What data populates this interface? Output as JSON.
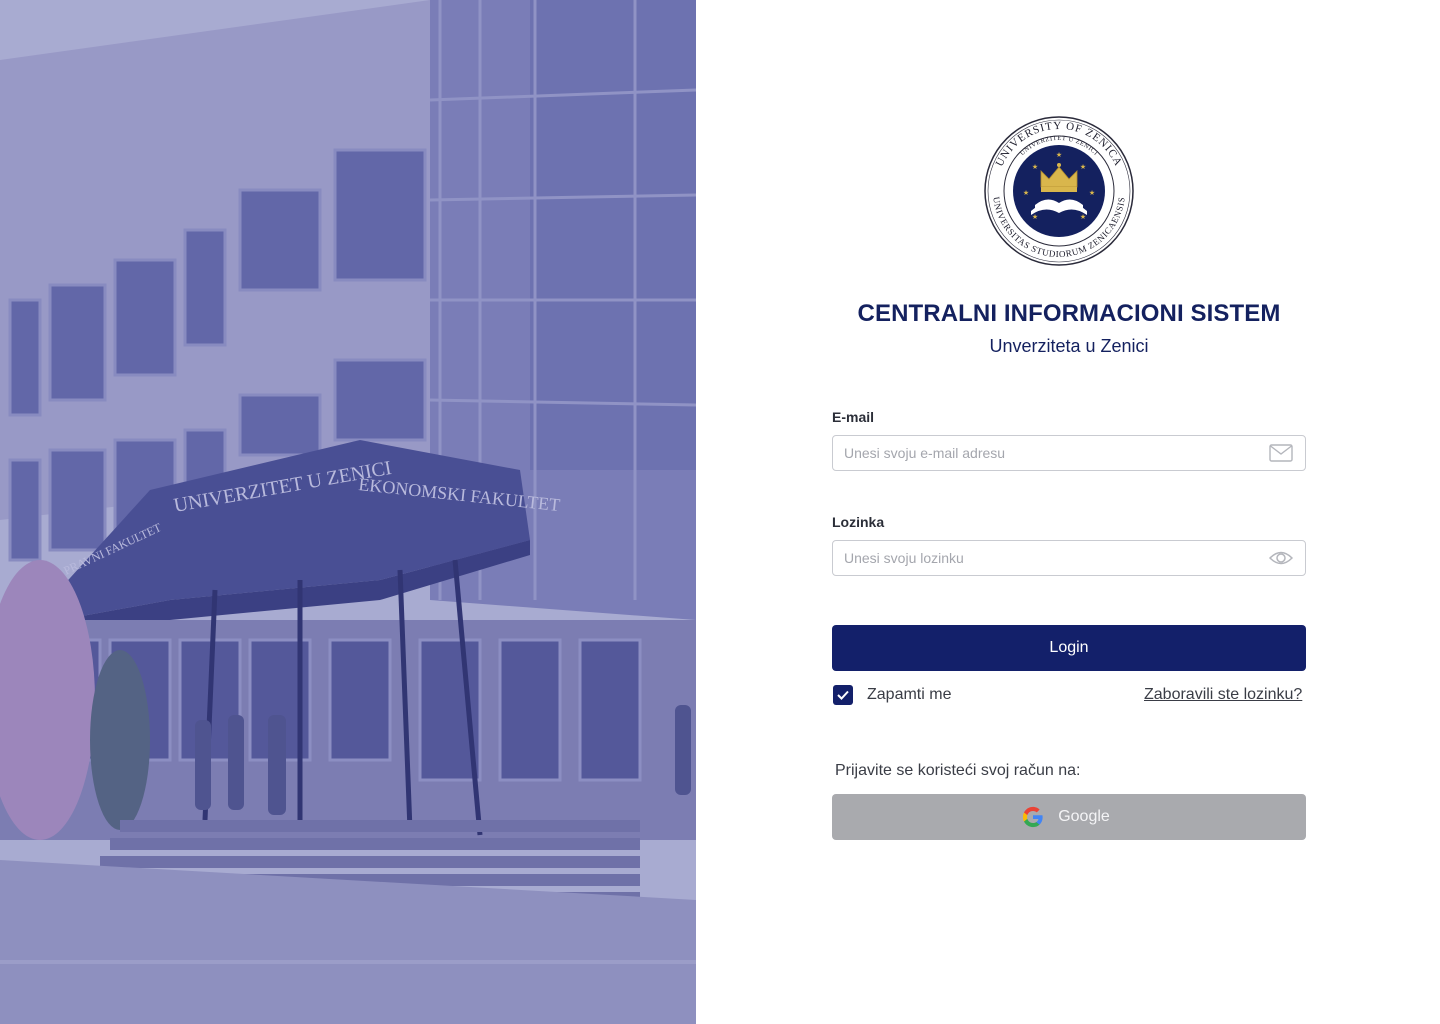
{
  "hero": {
    "image_description_hidden": "",
    "building_sign_left": "UNIVERZITET U ZENICI",
    "building_sign_right": "EKONOMSKI FAKULTET",
    "building_sign_side": "PRAVNI FAKULTET"
  },
  "brand": {
    "seal_text_outer": "UNIVERSITY OF ZENICA",
    "seal_text_inner": "UNIVERZITET U ZENICI",
    "seal_text_bottom": "UNIVERSITAS STUDIORUM ZENICAENSIS",
    "title": "CENTRALNI INFORMACIONI SISTEM",
    "subtitle": "Unverziteta u Zenici",
    "color": "#14215f"
  },
  "form": {
    "email_label": "E-mail",
    "email_placeholder": "Unesi svoju e-mail adresu",
    "email_value": "",
    "email_icon": "envelope-icon",
    "password_label": "Lozinka",
    "password_placeholder": "Unesi svoju lozinku",
    "password_value": "",
    "password_icon": "eye-icon",
    "login_label": "Login",
    "remember_label": "Zapamti me",
    "remember_checked": true,
    "forgot_label": "Zaboravili ste lozinku?",
    "social_label": "Prijavite se koristeći svoj račun na:",
    "google_label": "Google",
    "primary_color": "#13206a"
  }
}
